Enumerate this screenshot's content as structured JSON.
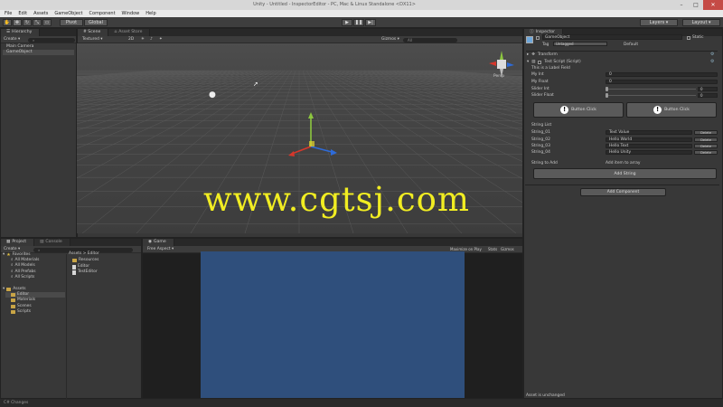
{
  "window": {
    "title": "Unity - Untitled - InspectorEditor - PC, Mac & Linux Standalone <DX11>"
  },
  "menu": [
    "File",
    "Edit",
    "Assets",
    "GameObject",
    "Component",
    "Window",
    "Help"
  ],
  "toolbar": {
    "pivot": "Pivot",
    "global": "Global",
    "layers": "Layers",
    "layout": "Layout"
  },
  "hierarchy": {
    "tab": "Hierarchy",
    "create": "Create",
    "items": [
      "Main Camera",
      "GameObject"
    ]
  },
  "scene": {
    "tab_scene": "# Scene",
    "tab_store": "Asset Store",
    "shading": "Textured",
    "mode_2d": "2D",
    "gizmos": "Gizmos",
    "search": "All",
    "persp": "Persp"
  },
  "watermark": "www.cgtsj.com",
  "inspector": {
    "tab": "Inspector",
    "object_name": "GameObject",
    "tag_label": "Tag",
    "tag_value": "Untagged",
    "layer_label": "Layer",
    "layer_value": "Default",
    "static": "Static",
    "transform": "Transform",
    "component": "Test Script (Script)",
    "script_field": "This is a Label Field",
    "fields": [
      {
        "label": "My Int",
        "value": "0"
      },
      {
        "label": "My Float",
        "value": "0"
      }
    ],
    "sliders": [
      {
        "label": "Slider Int",
        "value": "0"
      },
      {
        "label": "Slider Float",
        "value": "0"
      }
    ],
    "button_left": "Button Click",
    "button_right": "Button Click",
    "string_list_label": "String List",
    "strings": [
      {
        "label": "String_01",
        "value": "Text Value",
        "button": "Delete"
      },
      {
        "label": "String_02",
        "value": "Hello World",
        "button": "Delete"
      },
      {
        "label": "String_03",
        "value": "Hello Text",
        "button": "Delete"
      },
      {
        "label": "String_04",
        "value": "Hello Unity",
        "button": "Delete"
      }
    ],
    "string_to_add_label": "String to Add",
    "string_to_add_value": "Add item to array",
    "add_string": "Add String",
    "add_component": "Add Component",
    "asset_label": "Asset is unchanged"
  },
  "project": {
    "tab_project": "Project",
    "tab_console": "Console",
    "create": "Create",
    "favorites_label": "Favorites",
    "favorites": [
      "All Materials",
      "All Models",
      "All Prefabs",
      "All Scripts"
    ],
    "assets_label": "Assets",
    "asset_tree": [
      "Editor",
      "Materials",
      "Scenes",
      "Scripts"
    ],
    "breadcrumb": "Assets > Editor",
    "files": [
      "Resources",
      "Editor",
      "TestEditor"
    ]
  },
  "game": {
    "tab": "Game",
    "display": "Free Aspect",
    "maximize": "Maximize on Play",
    "stats": "Stats",
    "gizmos": "Gizmos"
  },
  "status": "C# Changes"
}
